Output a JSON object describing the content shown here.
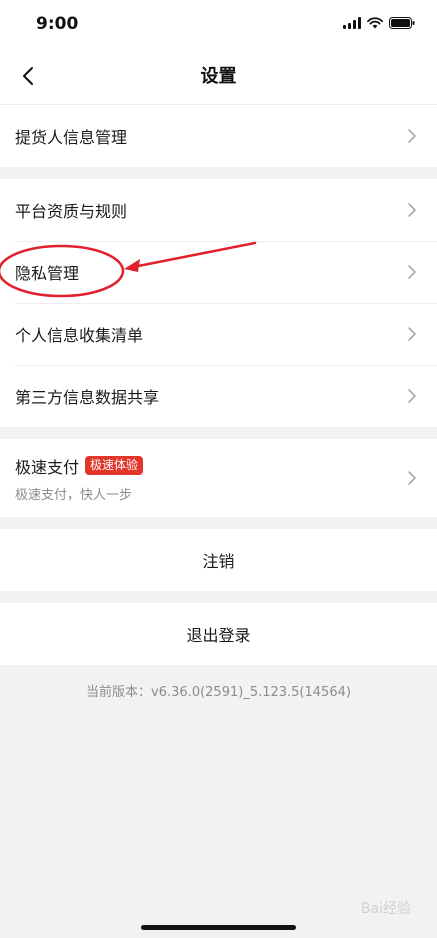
{
  "status_bar": {
    "time": "9:00"
  },
  "nav": {
    "title": "设置"
  },
  "groups": {
    "g1": [
      {
        "label": "提货人信息管理"
      }
    ],
    "g2": [
      {
        "label": "平台资质与规则"
      },
      {
        "label": "隐私管理"
      },
      {
        "label": "个人信息收集清单"
      },
      {
        "label": "第三方信息数据共享"
      }
    ]
  },
  "fast_pay": {
    "title": "极速支付",
    "badge": "极速体验",
    "subtitle": "极速支付，快人一步"
  },
  "cancel_label": "注销",
  "logout_label": "退出登录",
  "version_text": "当前版本：v6.36.0(2591)_5.123.5(14564)",
  "watermark": "Bai经验",
  "colors": {
    "accent": "#e3362b",
    "annotation": "#e0202a"
  }
}
